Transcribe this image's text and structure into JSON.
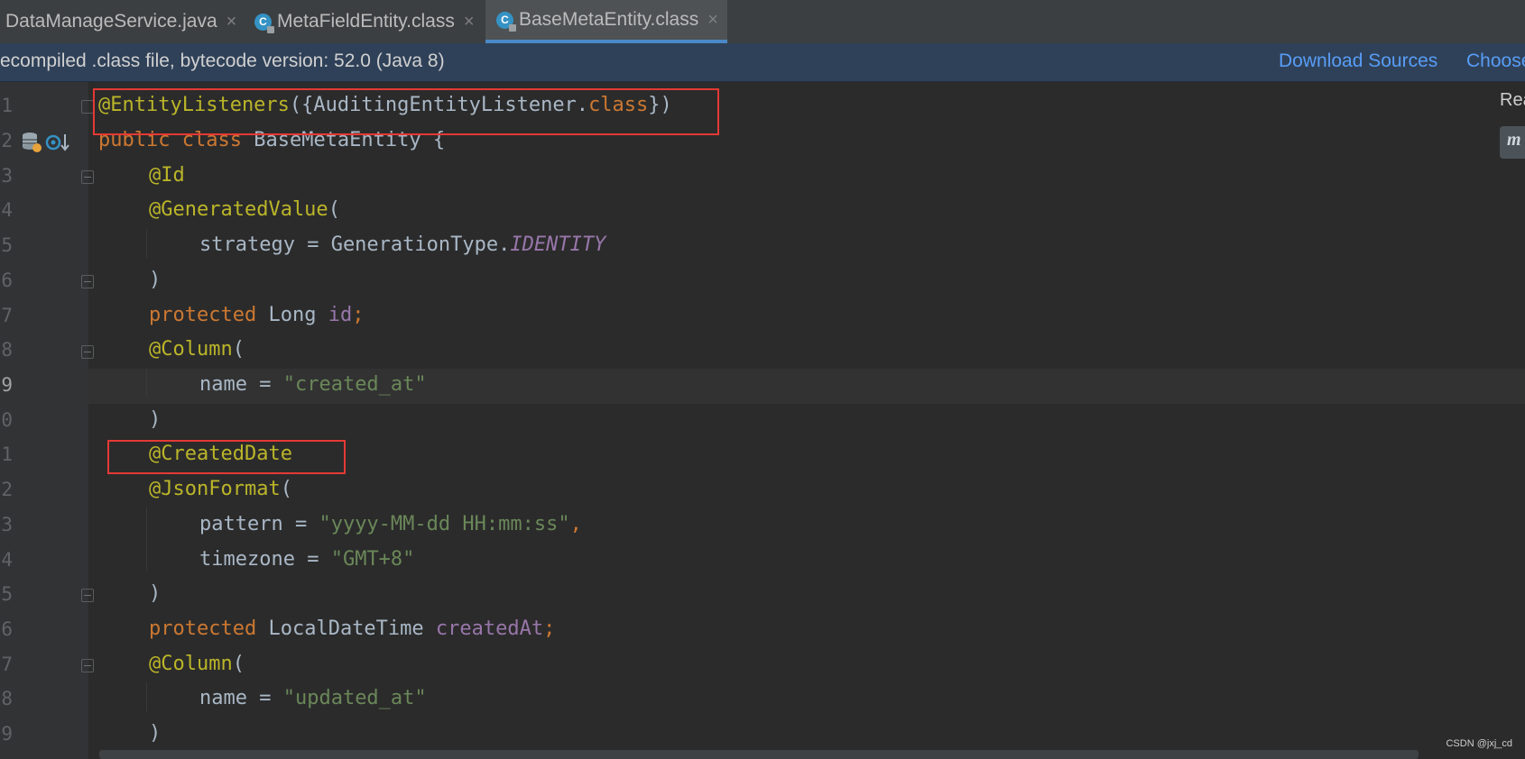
{
  "tabs": [
    {
      "label": "DataManageService.java",
      "close": "×"
    },
    {
      "label": "MetaFieldEntity.class",
      "close": "×",
      "icon_letter": "C"
    },
    {
      "label": "BaseMetaEntity.class",
      "close": "×",
      "icon_letter": "C",
      "active": true
    }
  ],
  "infobar": {
    "message": "ecompiled .class file, bytecode version: 52.0 (Java 8)",
    "download_sources": "Download Sources",
    "choose_sources": "Choose"
  },
  "line_numbers": [
    "1",
    "2",
    "3",
    "4",
    "5",
    "6",
    "7",
    "8",
    "9",
    "0",
    "1",
    "2",
    "3",
    "4",
    "5",
    "6",
    "7",
    "8",
    "9"
  ],
  "current_line_index": 8,
  "code": {
    "l1_ann": "@EntityListeners",
    "l1_open": "({AuditingEntityListener.",
    "l1_kw": "class",
    "l1_close": "})",
    "l2_public": "public",
    "l2_class": "class",
    "l2_name": "BaseMetaEntity {",
    "l3": "@Id",
    "l4_ann": "@GeneratedValue",
    "l4_paren": "(",
    "l5_key": "strategy = GenerationType.",
    "l5_val": "IDENTITY",
    "l6": ")",
    "l7_kw": "protected",
    "l7_type": "Long",
    "l7_field": "id",
    "l7_semi": ";",
    "l8_ann": "@Column",
    "l8_paren": "(",
    "l9_key": "name = ",
    "l9_val": "\"created_at\"",
    "l10": ")",
    "l11": "@CreatedDate",
    "l12_ann": "@JsonFormat",
    "l12_paren": "(",
    "l13_key": "pattern = ",
    "l13_val": "\"yyyy-MM-dd HH:mm:ss\"",
    "l13_comma": ",",
    "l14_key": "timezone = ",
    "l14_val": "\"GMT+8\"",
    "l15": ")",
    "l16_kw": "protected",
    "l16_type": "LocalDateTime",
    "l16_field": "createdAt",
    "l16_semi": ";",
    "l17_ann": "@Column",
    "l17_paren": "(",
    "l18_key": "name = ",
    "l18_val": "\"updated_at\"",
    "l19": ")"
  },
  "right_panel": {
    "label": "Rea",
    "badge": "m"
  },
  "watermark": "CSDN @jxj_cd",
  "colors": {
    "annotation": "#bbb529",
    "keyword": "#cc7832",
    "string": "#6a8759",
    "field": "#9876aa",
    "highlight_box": "#e53935"
  }
}
